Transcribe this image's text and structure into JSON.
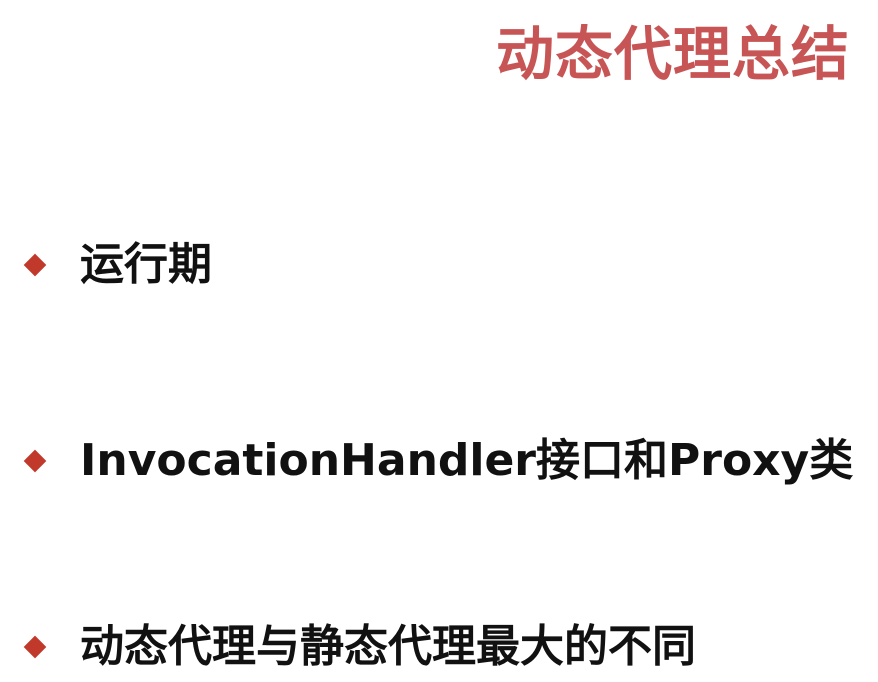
{
  "slide": {
    "title": "动态代理总结",
    "title_color": "#c85555",
    "bullet_color": "#c0392b",
    "bullets": [
      {
        "icon": "diamond-bullet-icon",
        "text": "运行期"
      },
      {
        "icon": "diamond-bullet-icon",
        "text": "InvocationHandler接口和Proxy类"
      },
      {
        "icon": "diamond-bullet-icon",
        "text": "动态代理与静态代理最大的不同"
      }
    ]
  }
}
